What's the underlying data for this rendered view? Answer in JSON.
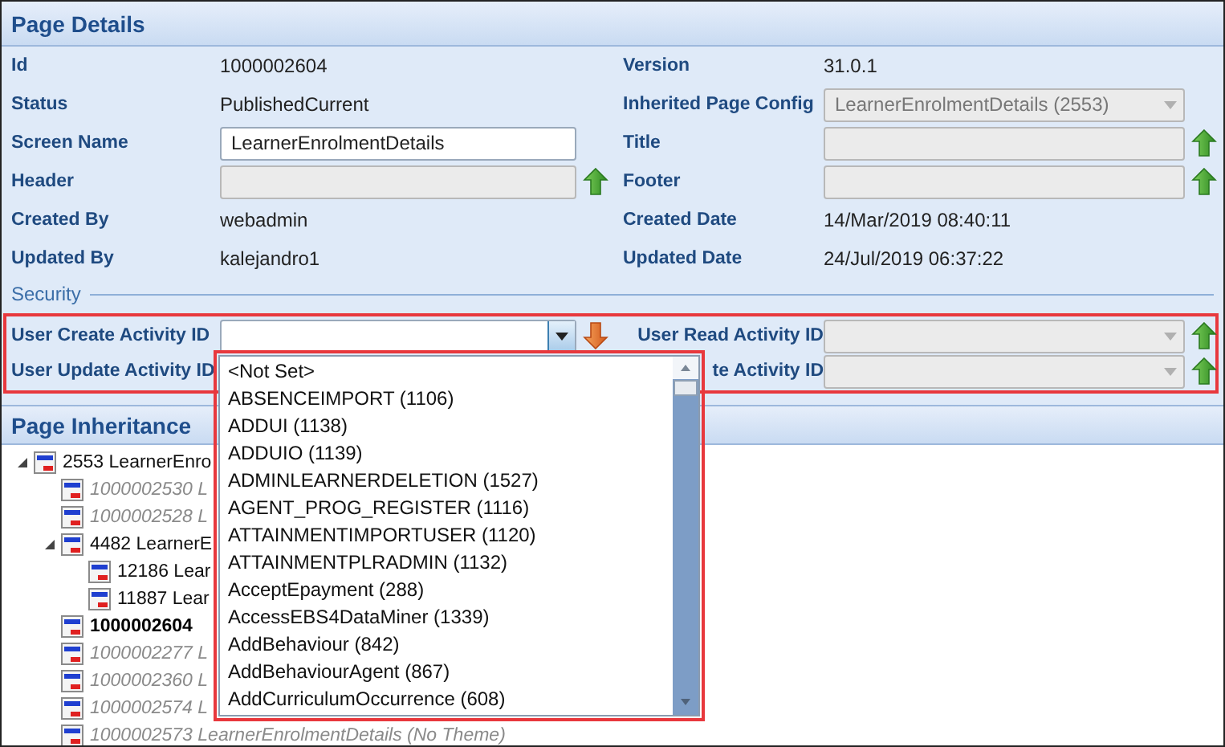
{
  "page_details": {
    "title": "Page Details",
    "left": [
      {
        "label": "Id",
        "kind": "text",
        "value": "1000002604"
      },
      {
        "label": "Status",
        "kind": "text",
        "value": "PublishedCurrent"
      },
      {
        "label": "Screen Name",
        "kind": "input",
        "value": "LearnerEnrolmentDetails",
        "disabled": false
      },
      {
        "label": "Header",
        "kind": "input",
        "disabled": true,
        "inherit_button": true
      },
      {
        "label": "Created By",
        "kind": "text",
        "value": "webadmin"
      },
      {
        "label": "Updated By",
        "kind": "text",
        "value": "kalejandro1"
      }
    ],
    "right": [
      {
        "label": "Version",
        "kind": "text",
        "value": "31.0.1"
      },
      {
        "label": "Inherited Page Config",
        "kind": "select",
        "value": "LearnerEnrolmentDetails (2553)",
        "disabled": true
      },
      {
        "label": "Title",
        "kind": "input",
        "disabled": true,
        "inherit_button": true
      },
      {
        "label": "Footer",
        "kind": "input",
        "disabled": true,
        "inherit_button": true
      },
      {
        "label": "Created Date",
        "kind": "text",
        "value": "14/Mar/2019 08:40:11"
      },
      {
        "label": "Updated Date",
        "kind": "text",
        "value": "24/Jul/2019 06:37:22"
      }
    ]
  },
  "security": {
    "label": "Security",
    "left": [
      {
        "label": "User Create Activity ID",
        "kind": "select",
        "disabled": false,
        "expanded": true,
        "override_button": true,
        "options": [
          "<Not Set>",
          "ABSENCEIMPORT (1106)",
          "ADDUI (1138)",
          "ADDUIO (1139)",
          "ADMINLEARNERDELETION (1527)",
          "AGENT_PROG_REGISTER (1116)",
          "ATTAINMENTIMPORTUSER (1120)",
          "ATTAINMENTPLRADMIN (1132)",
          "AcceptEpayment (288)",
          "AccessEBS4DataMiner (1339)",
          "AddBehaviour (842)",
          "AddBehaviourAgent (867)",
          "AddCurriculumOccurrence (608)"
        ]
      },
      {
        "label": "User Update Activity ID",
        "kind": "covered"
      }
    ],
    "right": [
      {
        "label": "User Read Activity ID",
        "kind": "select",
        "disabled": true,
        "expanded": false,
        "inherit_button": true
      },
      {
        "label": "te Activity ID",
        "kind": "select",
        "disabled": true,
        "expanded": false,
        "inherit_button": true
      }
    ]
  },
  "page_inheritance": {
    "title": "Page Inheritance",
    "tree": [
      {
        "label": "2553 LearnerEnro",
        "kind": "normal",
        "expanded": true,
        "children": [
          {
            "label": "1000002530 L",
            "kind": "inactive"
          },
          {
            "label": "1000002528 L",
            "kind": "inactive"
          },
          {
            "label": "4482 LearnerE",
            "kind": "normal",
            "expanded": true,
            "children": [
              {
                "label": "12186 Lear",
                "kind": "normal"
              },
              {
                "label": "11887 Lear",
                "kind": "normal"
              }
            ]
          },
          {
            "label": "1000002604",
            "kind": "current"
          },
          {
            "label": "1000002277 L",
            "kind": "inactive"
          },
          {
            "label": "1000002360 L",
            "kind": "inactive"
          },
          {
            "label": "1000002574 L",
            "kind": "inactive"
          },
          {
            "label": "1000002573 LearnerEnrolmentDetails (No Theme)",
            "kind": "inactive"
          }
        ]
      }
    ]
  }
}
